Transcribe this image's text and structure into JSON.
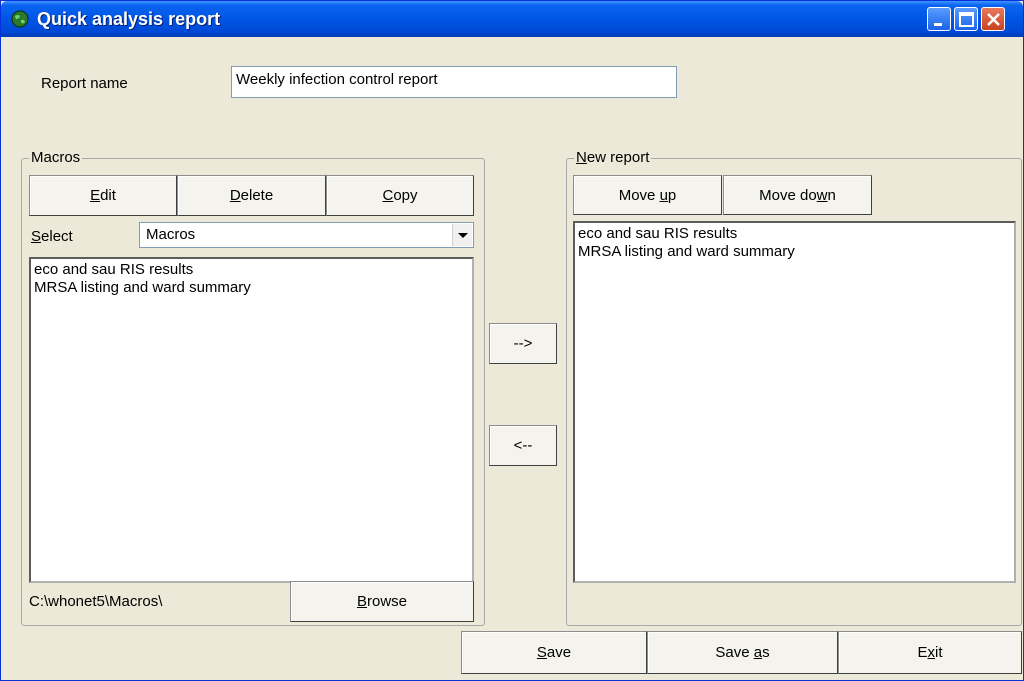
{
  "window": {
    "title": "Quick analysis report"
  },
  "report_name": {
    "label": "Report name",
    "value": "Weekly infection control report"
  },
  "macros_group": {
    "title": "Macros",
    "buttons": {
      "edit_pre": "",
      "edit_u": "E",
      "edit_post": "dit",
      "delete_pre": "",
      "delete_u": "D",
      "delete_post": "elete",
      "copy_pre": "",
      "copy_u": "C",
      "copy_post": "opy"
    },
    "select_label_u": "S",
    "select_label_post": "elect",
    "select_value": "Macros",
    "items": [
      "eco and sau RIS results",
      "MRSA listing and ward summary"
    ],
    "path": "C:\\whonet5\\Macros\\",
    "browse_u": "B",
    "browse_post": "rowse"
  },
  "transfer": {
    "add": "-->",
    "remove": "<--"
  },
  "new_report_group": {
    "title_u": "N",
    "title_post": "ew report",
    "move_up_pre": "Move ",
    "move_up_u": "u",
    "move_up_post": "p",
    "move_down_pre": "Move do",
    "move_down_u": "w",
    "move_down_post": "n",
    "items": [
      "eco and sau RIS results",
      "MRSA listing and ward summary"
    ]
  },
  "footer": {
    "save_u": "S",
    "save_post": "ave",
    "save_as_pre": "Save ",
    "save_as_u": "a",
    "save_as_post": "s",
    "exit_pre": "E",
    "exit_u": "x",
    "exit_post": "it"
  },
  "colors": {
    "titlebar": "#0155e5",
    "dialog_bg": "#ece9d8"
  }
}
